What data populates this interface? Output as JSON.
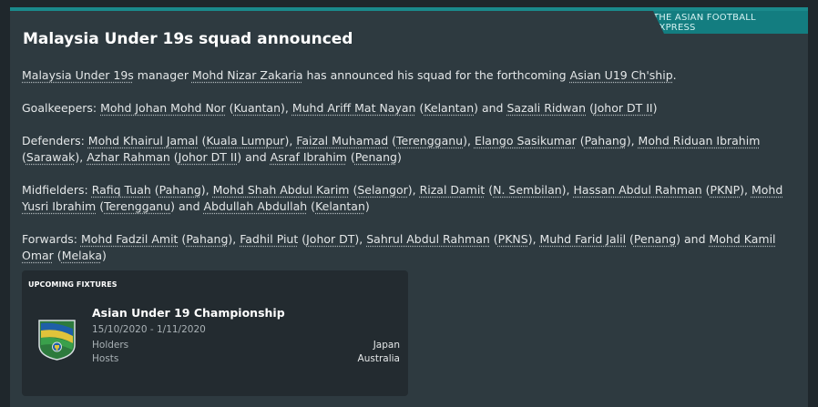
{
  "source": "THE ASIAN FOOTBALL EXPRESS",
  "headline": "Malaysia Under 19s squad announced",
  "paragraphs": [
    [
      {
        "t": "Malaysia Under 19s",
        "link": true
      },
      {
        "t": " manager "
      },
      {
        "t": "Mohd Nizar Zakaria",
        "link": true
      },
      {
        "t": " has announced his squad for the forthcoming "
      },
      {
        "t": "Asian U19 Ch'ship",
        "link": true
      },
      {
        "t": "."
      }
    ],
    [
      {
        "t": "Goalkeepers: "
      },
      {
        "t": "Mohd Johan Mohd Nor",
        "link": true
      },
      {
        "t": " ("
      },
      {
        "t": "Kuantan",
        "link": true
      },
      {
        "t": "), "
      },
      {
        "t": "Muhd Ariff Mat Nayan",
        "link": true
      },
      {
        "t": " ("
      },
      {
        "t": "Kelantan",
        "link": true
      },
      {
        "t": ") and "
      },
      {
        "t": "Sazali Ridwan",
        "link": true
      },
      {
        "t": " ("
      },
      {
        "t": "Johor DT II",
        "link": true
      },
      {
        "t": ")"
      }
    ],
    [
      {
        "t": "Defenders: "
      },
      {
        "t": "Mohd Khairul Jamal",
        "link": true
      },
      {
        "t": " ("
      },
      {
        "t": "Kuala Lumpur",
        "link": true
      },
      {
        "t": "), "
      },
      {
        "t": "Faizal Muhamad",
        "link": true
      },
      {
        "t": " ("
      },
      {
        "t": "Terengganu",
        "link": true
      },
      {
        "t": "), "
      },
      {
        "t": "Elango Sasikumar",
        "link": true
      },
      {
        "t": " ("
      },
      {
        "t": "Pahang",
        "link": true
      },
      {
        "t": "), "
      },
      {
        "t": "Mohd Riduan Ibrahim",
        "link": true
      },
      {
        "t": " ("
      },
      {
        "t": "Sarawak",
        "link": true
      },
      {
        "t": "), "
      },
      {
        "t": "Azhar Rahman",
        "link": true
      },
      {
        "t": " ("
      },
      {
        "t": "Johor DT II",
        "link": true
      },
      {
        "t": ") and "
      },
      {
        "t": "Asraf Ibrahim",
        "link": true
      },
      {
        "t": " ("
      },
      {
        "t": "Penang",
        "link": true
      },
      {
        "t": ")"
      }
    ],
    [
      {
        "t": "Midfielders: "
      },
      {
        "t": "Rafiq Tuah",
        "link": true
      },
      {
        "t": " ("
      },
      {
        "t": "Pahang",
        "link": true
      },
      {
        "t": "), "
      },
      {
        "t": "Mohd Shah Abdul Karim",
        "link": true
      },
      {
        "t": " ("
      },
      {
        "t": "Selangor",
        "link": true
      },
      {
        "t": "), "
      },
      {
        "t": "Rizal Damit",
        "link": true
      },
      {
        "t": " ("
      },
      {
        "t": "N. Sembilan",
        "link": true
      },
      {
        "t": "), "
      },
      {
        "t": "Hassan Abdul Rahman",
        "link": true
      },
      {
        "t": " ("
      },
      {
        "t": "PKNP",
        "link": true
      },
      {
        "t": "), "
      },
      {
        "t": "Mohd Yusri Ibrahim",
        "link": true
      },
      {
        "t": " ("
      },
      {
        "t": "Terengganu",
        "link": true
      },
      {
        "t": ") and "
      },
      {
        "t": "Abdullah Abdullah",
        "link": true
      },
      {
        "t": " ("
      },
      {
        "t": "Kelantan",
        "link": true
      },
      {
        "t": ")"
      }
    ],
    [
      {
        "t": "Forwards: "
      },
      {
        "t": "Mohd Fadzil Amit",
        "link": true
      },
      {
        "t": " ("
      },
      {
        "t": "Pahang",
        "link": true
      },
      {
        "t": "), "
      },
      {
        "t": "Fadhil Piut",
        "link": true
      },
      {
        "t": " ("
      },
      {
        "t": "Johor DT",
        "link": true
      },
      {
        "t": "), "
      },
      {
        "t": "Sahrul Abdul Rahman",
        "link": true
      },
      {
        "t": " ("
      },
      {
        "t": "PKNS",
        "link": true
      },
      {
        "t": "), "
      },
      {
        "t": "Muhd Farid Jalil",
        "link": true
      },
      {
        "t": " ("
      },
      {
        "t": "Penang",
        "link": true
      },
      {
        "t": ") and "
      },
      {
        "t": "Mohd Kamil Omar",
        "link": true
      },
      {
        "t": " ("
      },
      {
        "t": "Melaka",
        "link": true
      },
      {
        "t": ")"
      }
    ]
  ],
  "fixtures": {
    "title": "UPCOMING FIXTURES",
    "competition": "Asian Under 19 Championship",
    "dates": "15/10/2020  -  1/11/2020",
    "holders_label": "Holders",
    "holders_value": "Japan",
    "hosts_label": "Hosts",
    "hosts_value": "Australia",
    "logo_icon": "trophy-shield-icon"
  },
  "colors": {
    "accent": "#137d80",
    "panel": "#2e3a40",
    "background": "#1f272c"
  }
}
